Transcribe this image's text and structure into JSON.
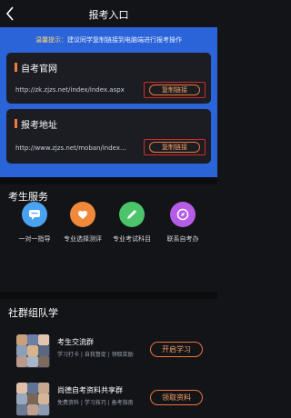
{
  "header": {
    "title": "报考入口",
    "back_icon": "chevron-left-icon"
  },
  "tip": {
    "label": "温馨提示：",
    "text": "建议同学复制链接到电脑端进行报考操作"
  },
  "links": [
    {
      "title": "自考官网",
      "url": "http://zk.zjzs.net/index/index.aspx",
      "button": "复制链接"
    },
    {
      "title": "报考地址",
      "url": "http://www.zjzs.net/moban/index...",
      "button": "复制链接"
    }
  ],
  "services": {
    "title": "考生服务",
    "items": [
      {
        "label": "一对一指导",
        "icon": "chat-bubble-icon",
        "color": "#4aa3f0"
      },
      {
        "label": "专业选择测评",
        "icon": "like-icon",
        "color": "#f08a3a"
      },
      {
        "label": "专业考试科目",
        "icon": "pencil-icon",
        "color": "#4cc46a"
      },
      {
        "label": "联系自考办",
        "icon": "compass-icon",
        "color": "#b65de8"
      }
    ]
  },
  "groups": {
    "title": "社群组队学",
    "items": [
      {
        "name": "考生交流群",
        "sub": "学习打卡 | 自我督促 | 领取奖励",
        "button": "开启学习"
      },
      {
        "name": "尚德自考资料共享群",
        "sub": "免费资料 | 学习技巧 | 备考指南",
        "button": "领取资料"
      }
    ]
  },
  "colors": {
    "accent_blue": "#2b64d8",
    "accent_orange": "#e8753a",
    "highlight_red": "#d02a2a"
  }
}
